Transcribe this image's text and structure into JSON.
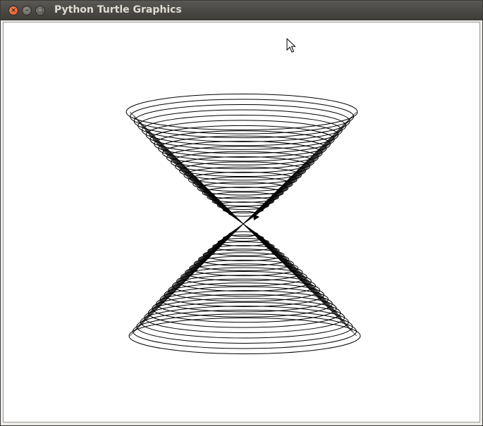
{
  "window": {
    "title": "Python Turtle Graphics",
    "close_glyph": "×",
    "minimize_glyph": "–",
    "maximize_glyph": "□"
  },
  "canvas": {
    "background": "#ffffff",
    "stroke_color": "#000000",
    "drawing": "turtle-hourglass-ellipses"
  },
  "icons": {
    "cursor": "arrow-pointer-icon",
    "turtle": "turtle-arrow-icon"
  }
}
